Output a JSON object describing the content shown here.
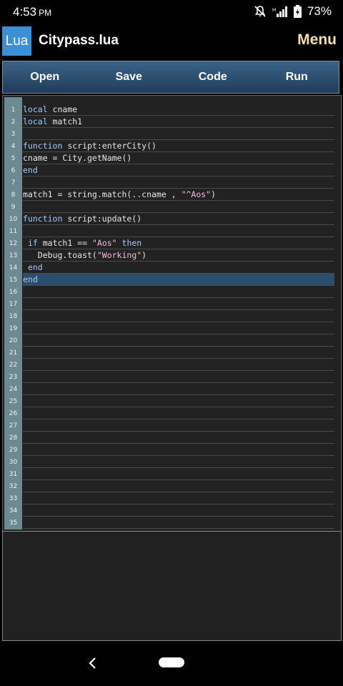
{
  "status": {
    "time": "4:53",
    "ampm": "PM",
    "battery": "73%"
  },
  "app": {
    "logo": "Lua",
    "title": "Citypass.lua",
    "menu_label": "Menu"
  },
  "toolbar": {
    "open": "Open",
    "save": "Save",
    "code": "Code",
    "run": "Run"
  },
  "editor": {
    "active_line": 15,
    "line_count": 35,
    "lines": [
      [
        [
          "kw",
          "local"
        ],
        [
          "t",
          " cname"
        ]
      ],
      [
        [
          "kw",
          "local"
        ],
        [
          "t",
          " match1"
        ]
      ],
      [],
      [
        [
          "kw",
          "function"
        ],
        [
          "t",
          " script:enterCity()"
        ]
      ],
      [
        [
          "t",
          "cname = City.getName()"
        ]
      ],
      [
        [
          "kw",
          "end"
        ]
      ],
      [],
      [
        [
          "t",
          "match1 = string.match(..cname , "
        ],
        [
          "str",
          "\"^Aos\""
        ],
        [
          "t",
          ")"
        ]
      ],
      [],
      [
        [
          "kw",
          "function"
        ],
        [
          "t",
          " script:update()"
        ]
      ],
      [],
      [
        [
          "t",
          " "
        ],
        [
          "kw",
          "if"
        ],
        [
          "t",
          " match1 == "
        ],
        [
          "str",
          "\"Aos\""
        ],
        [
          "t",
          " "
        ],
        [
          "kw",
          "then"
        ]
      ],
      [
        [
          "t",
          "   Debug.toast("
        ],
        [
          "str",
          "\"Working\""
        ],
        [
          "t",
          ")"
        ]
      ],
      [
        [
          "t",
          " "
        ],
        [
          "kw",
          "end"
        ]
      ],
      [
        [
          "kw",
          "end"
        ]
      ]
    ]
  },
  "colors": {
    "toolbar_top": "#3b6286",
    "toolbar_bottom": "#1f3d5a",
    "logo_bg": "#3a8fd6",
    "menu_text": "#f6dda7",
    "keyword": "#9ecbff",
    "string": "#f6b9dd",
    "active_line": "#2c4e6d",
    "gutter": "#6d8992"
  },
  "icons": [
    "notifications-off-icon",
    "signal-icon",
    "battery-icon",
    "back-icon",
    "home-pill-icon"
  ]
}
